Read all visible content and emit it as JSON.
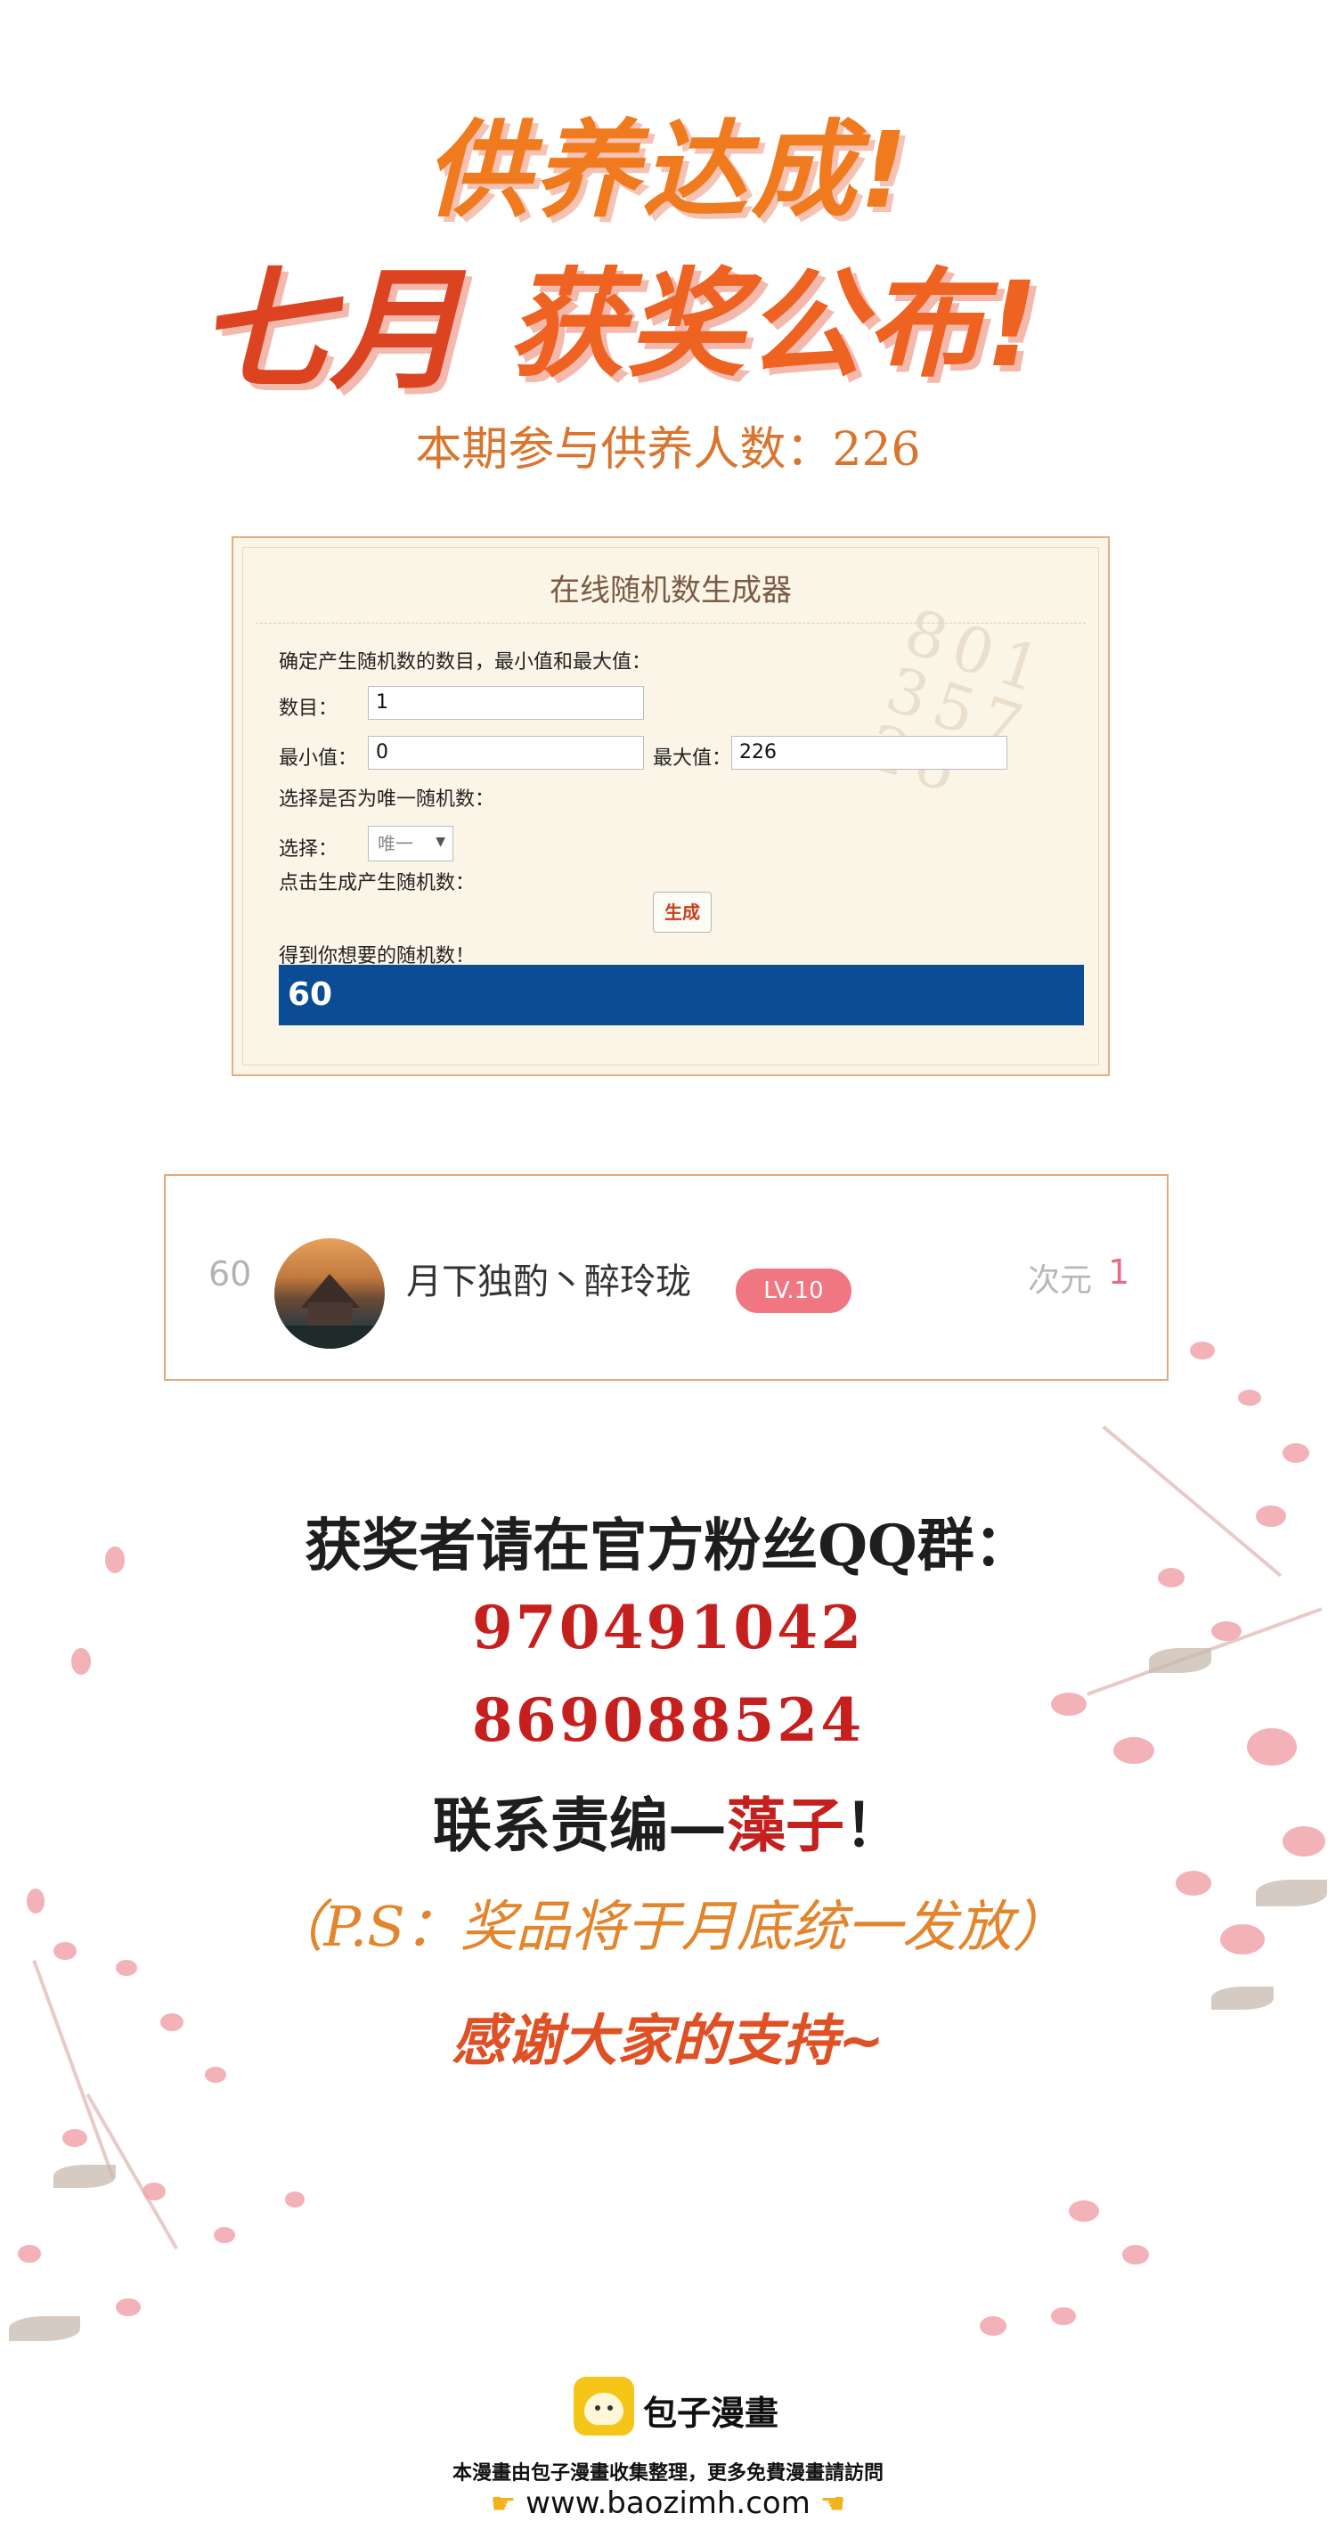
{
  "header": {
    "headline": "供养达成!",
    "month": "七月",
    "award_title": "获奖公布!",
    "participants": "本期参与供养人数：226"
  },
  "generator": {
    "title": "在线随机数生成器",
    "intro": "确定产生随机数的数目，最小值和最大值：",
    "count_label": "数目：",
    "count_value": "1",
    "min_label": "最小值：",
    "min_value": "0",
    "max_label": "最大值：",
    "max_value": "226",
    "unique_prompt": "选择是否为唯一随机数：",
    "select_label": "选择：",
    "select_value": "唯一",
    "click_prompt": "点击生成产生随机数：",
    "button_label": "生成",
    "result_prompt": "得到你想要的随机数！",
    "result_value": "60"
  },
  "winner": {
    "rank": "60",
    "username": "月下独酌丶醉玲珑",
    "level": "LV.10",
    "dimension_label": "次元",
    "dimension_value": "1"
  },
  "announcement": {
    "qq_line": "获奖者请在官方粉丝QQ群：",
    "qq_group_1": "970491042",
    "qq_group_2": "869088524",
    "contact_prefix": "联系责编—",
    "editor": "藻子",
    "contact_suffix": "！",
    "ps": "（P.S：奖品将于月底统一发放）",
    "thanks": "感谢大家的支持~"
  },
  "footer": {
    "brand": "包子漫畫",
    "notice": "本漫畫由包子漫畫收集整理，更多免費漫畫請訪問",
    "url": "www.baozimh.com"
  },
  "colors": {
    "headline": "#f07a1e",
    "accent_red": "#c5201e",
    "result_bar": "#0c4c94",
    "level_badge": "#f07682"
  },
  "icons": [
    "avatar-image",
    "hand-pointing-right-icon",
    "hand-pointing-left-icon",
    "baozi-logo-icon"
  ]
}
